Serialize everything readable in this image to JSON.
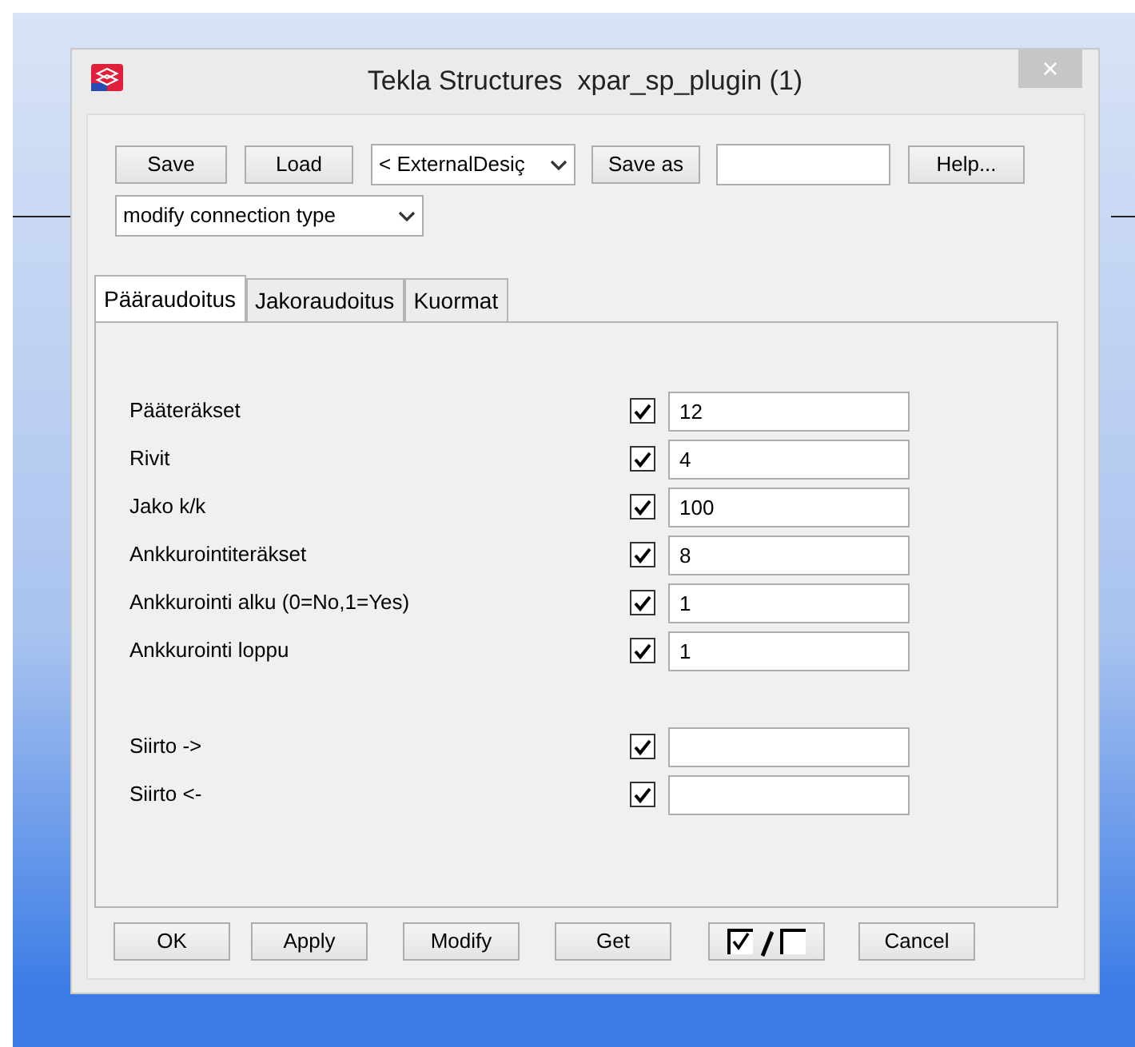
{
  "window": {
    "title": "Tekla Structures  xpar_sp_plugin (1)",
    "close": "×"
  },
  "toolbar": {
    "save": "Save",
    "load": "Load",
    "preset": "< ExternalDesiç",
    "save_as": "Save as",
    "help": "Help..."
  },
  "mode": {
    "value": "modify connection type"
  },
  "tabs": [
    {
      "label": "Pääraudoitus",
      "selected": true
    },
    {
      "label": "Jakoraudoitus",
      "selected": false
    },
    {
      "label": "Kuormat",
      "selected": false
    }
  ],
  "groups": [
    {
      "rows": [
        {
          "label": "Pääteräkset",
          "checked": true,
          "value": "12"
        },
        {
          "label": "Rivit",
          "checked": true,
          "value": "4"
        },
        {
          "label": "Jako k/k",
          "checked": true,
          "value": "100"
        },
        {
          "label": "Ankkurointiteräkset",
          "checked": true,
          "value": "8"
        },
        {
          "label": "Ankkurointi alku (0=No,1=Yes)",
          "checked": true,
          "value": "1"
        },
        {
          "label": "Ankkurointi loppu",
          "checked": true,
          "value": "1"
        }
      ]
    },
    {
      "rows": [
        {
          "label": "Siirto ->",
          "checked": true
        },
        {
          "label": "Siirto <-",
          "checked": true
        }
      ]
    }
  ],
  "buttons": [
    {
      "kind": "text",
      "label": "OK"
    },
    {
      "kind": "text",
      "label": "Apply"
    },
    {
      "kind": "text",
      "label": "Modify"
    },
    {
      "kind": "text",
      "label": "Get"
    },
    {
      "kind": "toggle"
    },
    {
      "kind": "text",
      "label": "Cancel"
    }
  ]
}
